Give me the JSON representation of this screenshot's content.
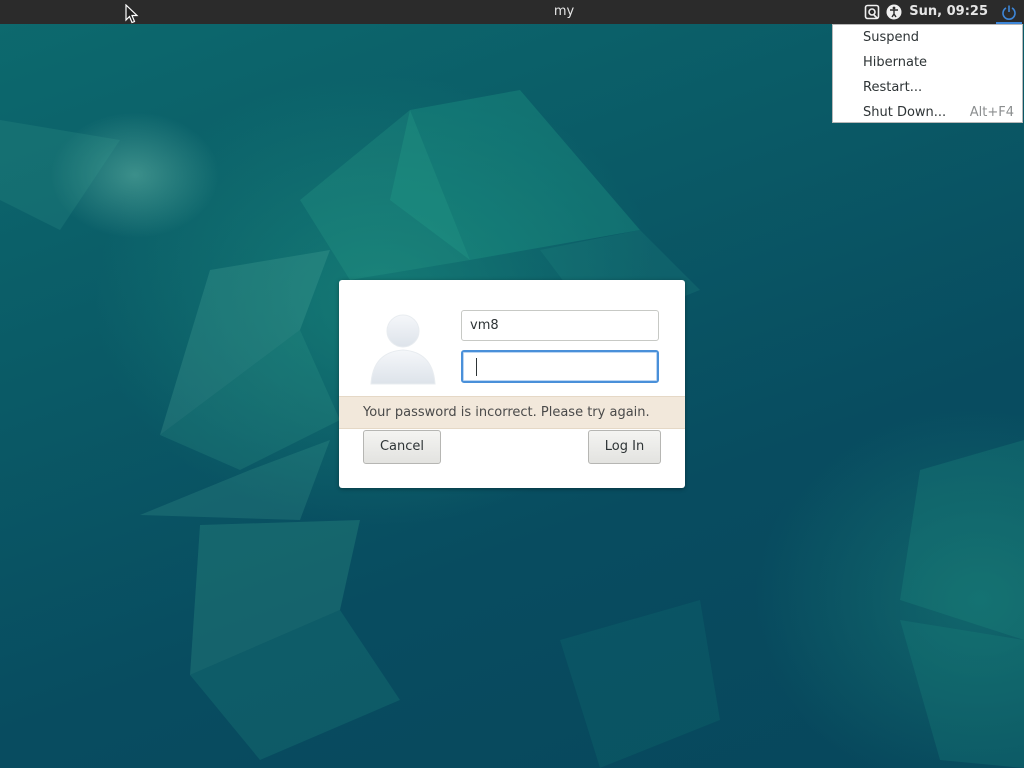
{
  "topbar": {
    "title": "my",
    "clock": "Sun, 09:25",
    "icons": [
      "display-refresh-icon",
      "accessibility-icon",
      "power-icon"
    ]
  },
  "power_menu": {
    "items": [
      {
        "label": "Suspend",
        "accel": ""
      },
      {
        "label": "Hibernate",
        "accel": ""
      },
      {
        "label": "Restart...",
        "accel": ""
      },
      {
        "label": "Shut Down...",
        "accel": "Alt+F4"
      }
    ]
  },
  "login": {
    "username": "vm8",
    "password": "",
    "error": "Your password is incorrect. Please try again.",
    "cancel_label": "Cancel",
    "login_label": "Log In"
  },
  "colors": {
    "topbar": "#2b2b2b",
    "focus_accent": "#4a90d9",
    "error_bg": "#f2e8db",
    "wallpaper": "#0b4f62"
  }
}
